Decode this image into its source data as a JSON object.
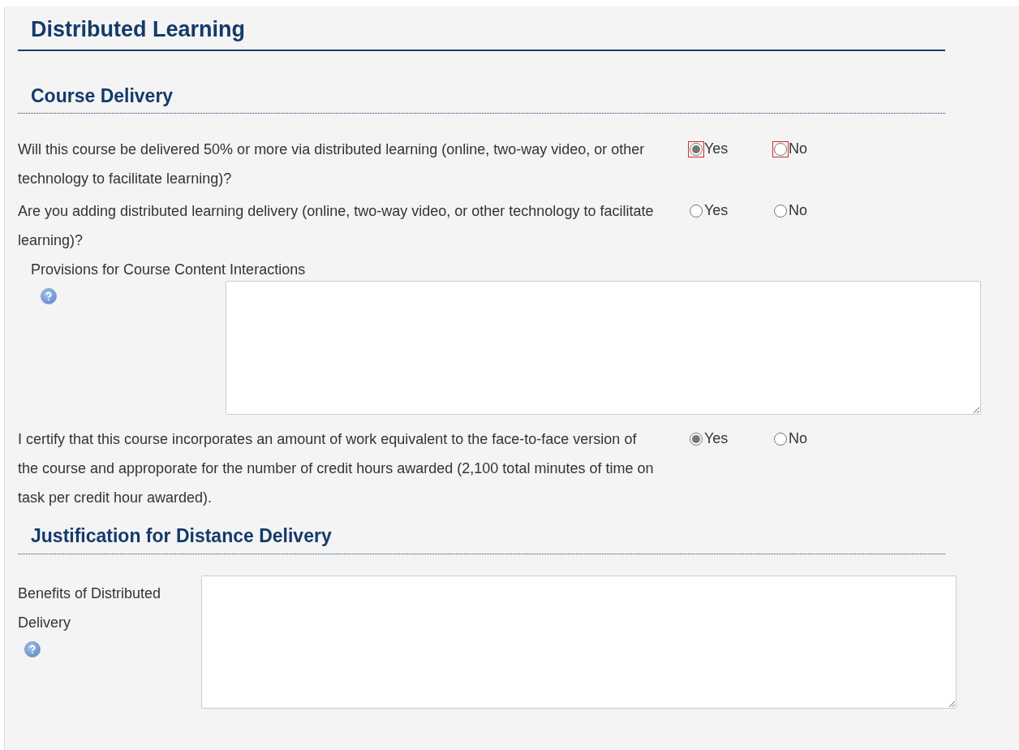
{
  "title": "Distributed Learning",
  "sections": [
    {
      "heading": "Course Delivery",
      "items": [
        {
          "kind": "radio",
          "question": "Will this course be delivered 50% or more via distributed learning (online, two-way video, or other technology to facilitate learning)?",
          "invalid": true,
          "options": [
            {
              "label": "Yes",
              "selected": true
            },
            {
              "label": "No",
              "selected": false
            }
          ]
        },
        {
          "kind": "radio",
          "question": "Are you adding distributed learning delivery (online, two-way video, or other technology to facilitate learning)?",
          "invalid": false,
          "options": [
            {
              "label": "Yes",
              "selected": false
            },
            {
              "label": "No",
              "selected": false
            }
          ]
        },
        {
          "kind": "textarea",
          "label": "Provisions for Course Content Interactions"
        },
        {
          "kind": "radio",
          "question": "I certify that this course incorporates an amount of work equivalent to the face-to-face version of the course and approporate for the number of credit hours awarded (2,100 total minutes of time on task per credit hour awarded).",
          "invalid": false,
          "options": [
            {
              "label": "Yes",
              "selected": true
            },
            {
              "label": "No",
              "selected": false
            }
          ]
        }
      ]
    },
    {
      "heading": "Justification for Distance Delivery",
      "items": [
        {
          "kind": "side_textarea",
          "label": "Benefits of Distributed Delivery"
        }
      ]
    }
  ]
}
